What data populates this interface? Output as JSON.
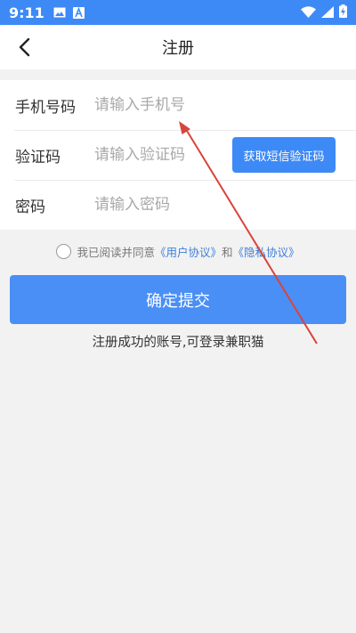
{
  "status_bar": {
    "time": "9:11",
    "left_icons": [
      "image-icon",
      "a-box-icon"
    ],
    "right_icons": [
      "wifi-icon",
      "signal-icon",
      "battery-charging-icon"
    ]
  },
  "header": {
    "title": "注册",
    "back_icon": "chevron-left-icon"
  },
  "form": {
    "phone": {
      "label": "手机号码",
      "placeholder": "请输入手机号",
      "value": ""
    },
    "code": {
      "label": "验证码",
      "placeholder": "请输入验证码",
      "value": "",
      "button_label": "获取短信验证码"
    },
    "password": {
      "label": "密码",
      "placeholder": "请输入密码",
      "value": ""
    }
  },
  "agreement": {
    "checked": false,
    "prefix": "我已阅读并同意",
    "user_agreement": "《用户协议》",
    "conjunction": "和",
    "privacy_policy": "《隐私协议》"
  },
  "submit_label": "确定提交",
  "note": "注册成功的账号,可登录兼职猫",
  "colors": {
    "accent": "#3d8af7",
    "link": "#3d7fd8",
    "annotation_arrow": "#d9443c",
    "background": "#f2f2f2"
  }
}
